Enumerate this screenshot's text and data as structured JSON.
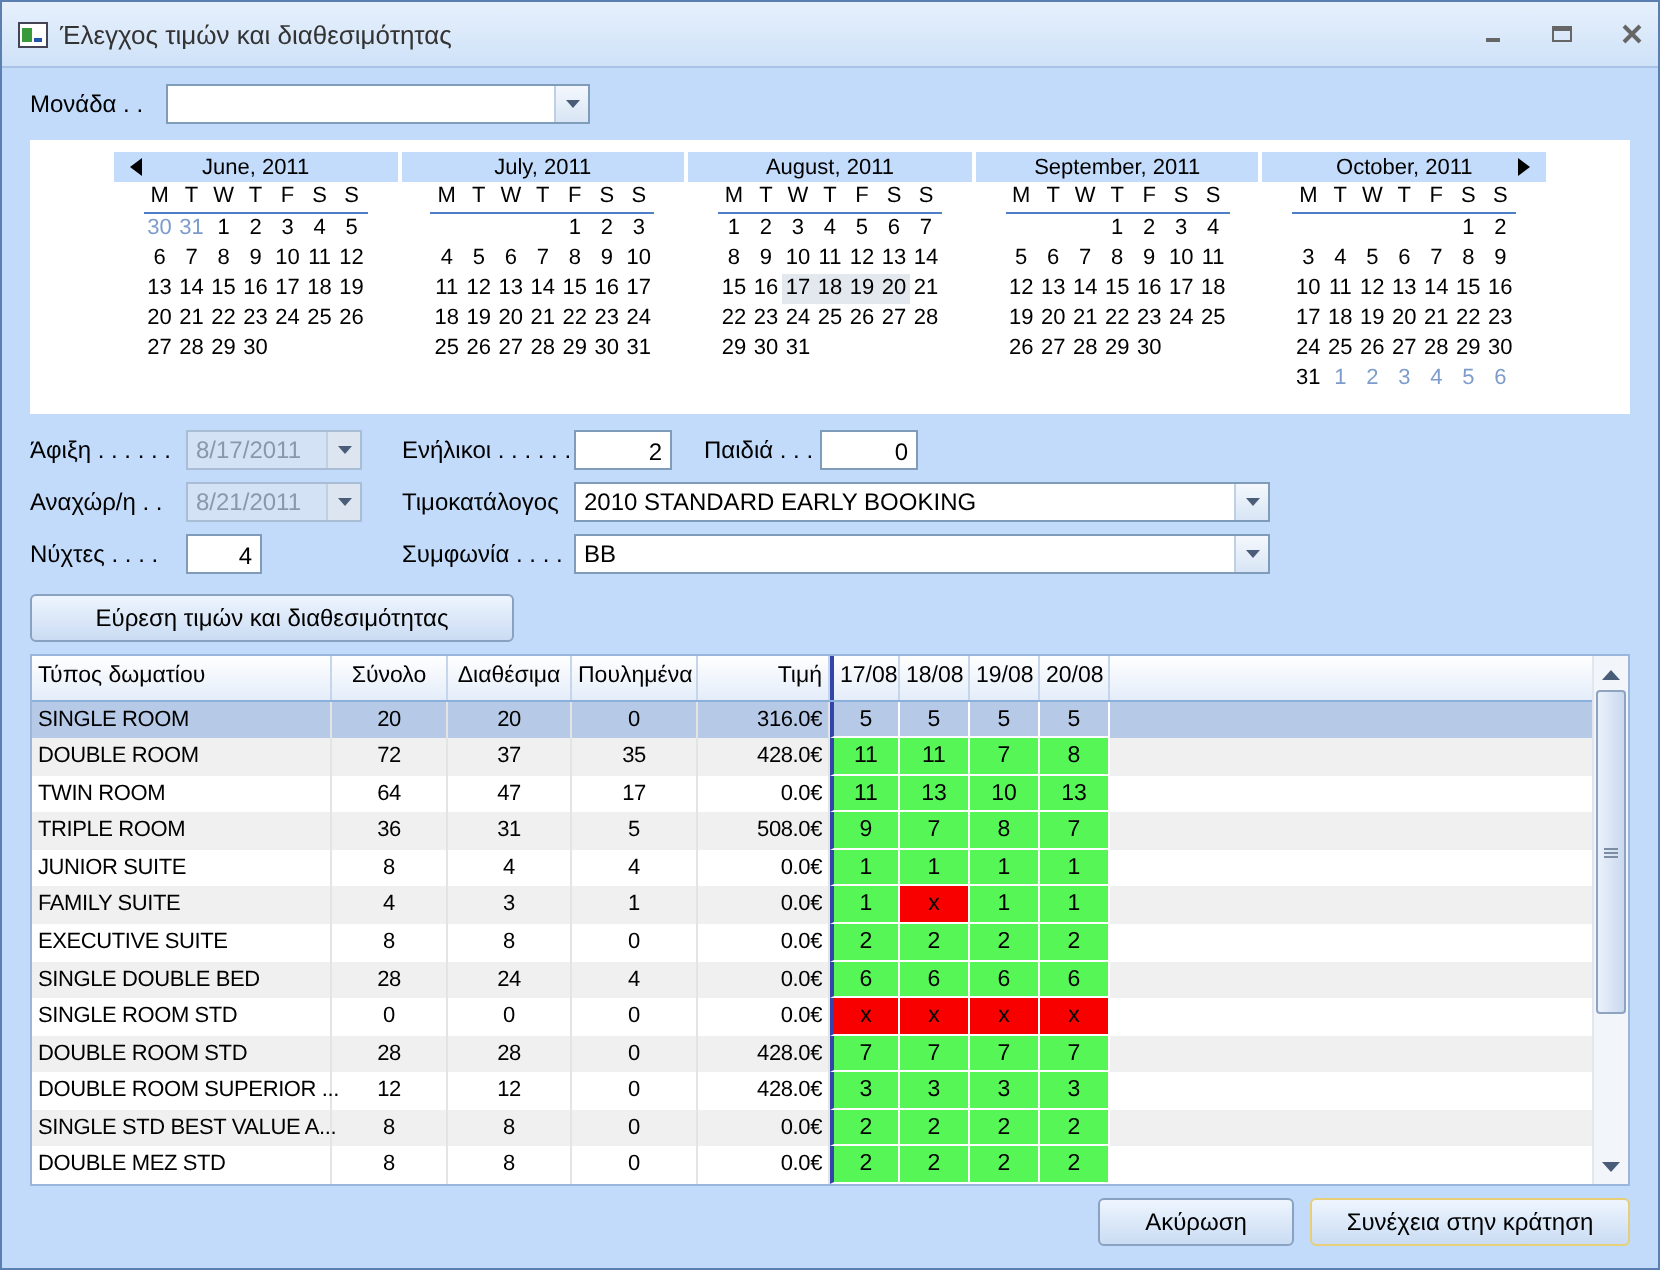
{
  "window": {
    "title": "Έλεγχος τιμών και διαθεσιμότητας"
  },
  "unit": {
    "label": "Μονάδα . ."
  },
  "calendar": {
    "months": [
      {
        "title": "June, 2011",
        "weekdays": [
          "M",
          "T",
          "W",
          "T",
          "F",
          "S",
          "S"
        ],
        "weeks": [
          {
            "days": [
              {
                "d": "30",
                "muted": true,
                "selected": false
              },
              {
                "d": "31",
                "muted": true,
                "selected": false
              },
              {
                "d": "1",
                "muted": false,
                "selected": false
              },
              {
                "d": "2",
                "muted": false,
                "selected": false
              },
              {
                "d": "3",
                "muted": false,
                "selected": false
              },
              {
                "d": "4",
                "muted": false,
                "selected": false
              },
              {
                "d": "5",
                "muted": false,
                "selected": false
              }
            ]
          },
          {
            "days": [
              {
                "d": "6",
                "muted": false,
                "selected": false
              },
              {
                "d": "7",
                "muted": false,
                "selected": false
              },
              {
                "d": "8",
                "muted": false,
                "selected": false
              },
              {
                "d": "9",
                "muted": false,
                "selected": false
              },
              {
                "d": "10",
                "muted": false,
                "selected": false
              },
              {
                "d": "11",
                "muted": false,
                "selected": false
              },
              {
                "d": "12",
                "muted": false,
                "selected": false
              }
            ]
          },
          {
            "days": [
              {
                "d": "13",
                "muted": false,
                "selected": false
              },
              {
                "d": "14",
                "muted": false,
                "selected": false
              },
              {
                "d": "15",
                "muted": false,
                "selected": false
              },
              {
                "d": "16",
                "muted": false,
                "selected": false
              },
              {
                "d": "17",
                "muted": false,
                "selected": false
              },
              {
                "d": "18",
                "muted": false,
                "selected": false
              },
              {
                "d": "19",
                "muted": false,
                "selected": false
              }
            ]
          },
          {
            "days": [
              {
                "d": "20",
                "muted": false,
                "selected": false
              },
              {
                "d": "21",
                "muted": false,
                "selected": false
              },
              {
                "d": "22",
                "muted": false,
                "selected": false
              },
              {
                "d": "23",
                "muted": false,
                "selected": false
              },
              {
                "d": "24",
                "muted": false,
                "selected": false
              },
              {
                "d": "25",
                "muted": false,
                "selected": false
              },
              {
                "d": "26",
                "muted": false,
                "selected": false
              }
            ]
          },
          {
            "days": [
              {
                "d": "27",
                "muted": false,
                "selected": false
              },
              {
                "d": "28",
                "muted": false,
                "selected": false
              },
              {
                "d": "29",
                "muted": false,
                "selected": false
              },
              {
                "d": "30",
                "muted": false,
                "selected": false
              }
            ]
          }
        ]
      },
      {
        "title": "July, 2011",
        "weekdays": [
          "M",
          "T",
          "W",
          "T",
          "F",
          "S",
          "S"
        ],
        "weeks": [
          {
            "days": [
              {
                "d": "1",
                "muted": false,
                "selected": false
              },
              {
                "d": "2",
                "muted": false,
                "selected": false
              },
              {
                "d": "3",
                "muted": false,
                "selected": false
              }
            ]
          },
          {
            "days": [
              {
                "d": "4",
                "muted": false,
                "selected": false
              },
              {
                "d": "5",
                "muted": false,
                "selected": false
              },
              {
                "d": "6",
                "muted": false,
                "selected": false
              },
              {
                "d": "7",
                "muted": false,
                "selected": false
              },
              {
                "d": "8",
                "muted": false,
                "selected": false
              },
              {
                "d": "9",
                "muted": false,
                "selected": false
              },
              {
                "d": "10",
                "muted": false,
                "selected": false
              }
            ]
          },
          {
            "days": [
              {
                "d": "11",
                "muted": false,
                "selected": false
              },
              {
                "d": "12",
                "muted": false,
                "selected": false
              },
              {
                "d": "13",
                "muted": false,
                "selected": false
              },
              {
                "d": "14",
                "muted": false,
                "selected": false
              },
              {
                "d": "15",
                "muted": false,
                "selected": false
              },
              {
                "d": "16",
                "muted": false,
                "selected": false
              },
              {
                "d": "17",
                "muted": false,
                "selected": false
              }
            ]
          },
          {
            "days": [
              {
                "d": "18",
                "muted": false,
                "selected": false
              },
              {
                "d": "19",
                "muted": false,
                "selected": false
              },
              {
                "d": "20",
                "muted": false,
                "selected": false
              },
              {
                "d": "21",
                "muted": false,
                "selected": false
              },
              {
                "d": "22",
                "muted": false,
                "selected": false
              },
              {
                "d": "23",
                "muted": false,
                "selected": false
              },
              {
                "d": "24",
                "muted": false,
                "selected": false
              }
            ]
          },
          {
            "days": [
              {
                "d": "25",
                "muted": false,
                "selected": false
              },
              {
                "d": "26",
                "muted": false,
                "selected": false
              },
              {
                "d": "27",
                "muted": false,
                "selected": false
              },
              {
                "d": "28",
                "muted": false,
                "selected": false
              },
              {
                "d": "29",
                "muted": false,
                "selected": false
              },
              {
                "d": "30",
                "muted": false,
                "selected": false
              },
              {
                "d": "31",
                "muted": false,
                "selected": false
              }
            ]
          }
        ]
      },
      {
        "title": "August, 2011",
        "weekdays": [
          "M",
          "T",
          "W",
          "T",
          "F",
          "S",
          "S"
        ],
        "weeks": [
          {
            "days": [
              {
                "d": "1",
                "muted": false,
                "selected": false
              },
              {
                "d": "2",
                "muted": false,
                "selected": false
              },
              {
                "d": "3",
                "muted": false,
                "selected": false
              },
              {
                "d": "4",
                "muted": false,
                "selected": false
              },
              {
                "d": "5",
                "muted": false,
                "selected": false
              },
              {
                "d": "6",
                "muted": false,
                "selected": false
              },
              {
                "d": "7",
                "muted": false,
                "selected": false
              }
            ]
          },
          {
            "days": [
              {
                "d": "8",
                "muted": false,
                "selected": false
              },
              {
                "d": "9",
                "muted": false,
                "selected": false
              },
              {
                "d": "10",
                "muted": false,
                "selected": false
              },
              {
                "d": "11",
                "muted": false,
                "selected": false
              },
              {
                "d": "12",
                "muted": false,
                "selected": false
              },
              {
                "d": "13",
                "muted": false,
                "selected": false
              },
              {
                "d": "14",
                "muted": false,
                "selected": false
              }
            ]
          },
          {
            "days": [
              {
                "d": "15",
                "muted": false,
                "selected": false
              },
              {
                "d": "16",
                "muted": false,
                "selected": false
              },
              {
                "d": "17",
                "muted": false,
                "selected": true
              },
              {
                "d": "18",
                "muted": false,
                "selected": true
              },
              {
                "d": "19",
                "muted": false,
                "selected": true
              },
              {
                "d": "20",
                "muted": false,
                "selected": true
              },
              {
                "d": "21",
                "muted": false,
                "selected": false
              }
            ]
          },
          {
            "days": [
              {
                "d": "22",
                "muted": false,
                "selected": false
              },
              {
                "d": "23",
                "muted": false,
                "selected": false
              },
              {
                "d": "24",
                "muted": false,
                "selected": false
              },
              {
                "d": "25",
                "muted": false,
                "selected": false
              },
              {
                "d": "26",
                "muted": false,
                "selected": false
              },
              {
                "d": "27",
                "muted": false,
                "selected": false
              },
              {
                "d": "28",
                "muted": false,
                "selected": false
              }
            ]
          },
          {
            "days": [
              {
                "d": "29",
                "muted": false,
                "selected": false
              },
              {
                "d": "30",
                "muted": false,
                "selected": false
              },
              {
                "d": "31",
                "muted": false,
                "selected": false
              }
            ]
          }
        ]
      },
      {
        "title": "September, 2011",
        "weekdays": [
          "M",
          "T",
          "W",
          "T",
          "F",
          "S",
          "S"
        ],
        "weeks": [
          {
            "days": [
              {
                "d": "1",
                "muted": false,
                "selected": false
              },
              {
                "d": "2",
                "muted": false,
                "selected": false
              },
              {
                "d": "3",
                "muted": false,
                "selected": false
              },
              {
                "d": "4",
                "muted": false,
                "selected": false
              }
            ]
          },
          {
            "days": [
              {
                "d": "5",
                "muted": false,
                "selected": false
              },
              {
                "d": "6",
                "muted": false,
                "selected": false
              },
              {
                "d": "7",
                "muted": false,
                "selected": false
              },
              {
                "d": "8",
                "muted": false,
                "selected": false
              },
              {
                "d": "9",
                "muted": false,
                "selected": false
              },
              {
                "d": "10",
                "muted": false,
                "selected": false
              },
              {
                "d": "11",
                "muted": false,
                "selected": false
              }
            ]
          },
          {
            "days": [
              {
                "d": "12",
                "muted": false,
                "selected": false
              },
              {
                "d": "13",
                "muted": false,
                "selected": false
              },
              {
                "d": "14",
                "muted": false,
                "selected": false
              },
              {
                "d": "15",
                "muted": false,
                "selected": false
              },
              {
                "d": "16",
                "muted": false,
                "selected": false
              },
              {
                "d": "17",
                "muted": false,
                "selected": false
              },
              {
                "d": "18",
                "muted": false,
                "selected": false
              }
            ]
          },
          {
            "days": [
              {
                "d": "19",
                "muted": false,
                "selected": false
              },
              {
                "d": "20",
                "muted": false,
                "selected": false
              },
              {
                "d": "21",
                "muted": false,
                "selected": false
              },
              {
                "d": "22",
                "muted": false,
                "selected": false
              },
              {
                "d": "23",
                "muted": false,
                "selected": false
              },
              {
                "d": "24",
                "muted": false,
                "selected": false
              },
              {
                "d": "25",
                "muted": false,
                "selected": false
              }
            ]
          },
          {
            "days": [
              {
                "d": "26",
                "muted": false,
                "selected": false
              },
              {
                "d": "27",
                "muted": false,
                "selected": false
              },
              {
                "d": "28",
                "muted": false,
                "selected": false
              },
              {
                "d": "29",
                "muted": false,
                "selected": false
              },
              {
                "d": "30",
                "muted": false,
                "selected": false
              }
            ]
          }
        ]
      },
      {
        "title": "October, 2011",
        "weekdays": [
          "M",
          "T",
          "W",
          "T",
          "F",
          "S",
          "S"
        ],
        "weeks": [
          {
            "days": [
              {
                "d": "1",
                "muted": false,
                "selected": false
              },
              {
                "d": "2",
                "muted": false,
                "selected": false
              }
            ]
          },
          {
            "days": [
              {
                "d": "3",
                "muted": false,
                "selected": false
              },
              {
                "d": "4",
                "muted": false,
                "selected": false
              },
              {
                "d": "5",
                "muted": false,
                "selected": false
              },
              {
                "d": "6",
                "muted": false,
                "selected": false
              },
              {
                "d": "7",
                "muted": false,
                "selected": false
              },
              {
                "d": "8",
                "muted": false,
                "selected": false
              },
              {
                "d": "9",
                "muted": false,
                "selected": false
              }
            ]
          },
          {
            "days": [
              {
                "d": "10",
                "muted": false,
                "selected": false
              },
              {
                "d": "11",
                "muted": false,
                "selected": false
              },
              {
                "d": "12",
                "muted": false,
                "selected": false
              },
              {
                "d": "13",
                "muted": false,
                "selected": false
              },
              {
                "d": "14",
                "muted": false,
                "selected": false
              },
              {
                "d": "15",
                "muted": false,
                "selected": false
              },
              {
                "d": "16",
                "muted": false,
                "selected": false
              }
            ]
          },
          {
            "days": [
              {
                "d": "17",
                "muted": false,
                "selected": false
              },
              {
                "d": "18",
                "muted": false,
                "selected": false
              },
              {
                "d": "19",
                "muted": false,
                "selected": false
              },
              {
                "d": "20",
                "muted": false,
                "selected": false
              },
              {
                "d": "21",
                "muted": false,
                "selected": false
              },
              {
                "d": "22",
                "muted": false,
                "selected": false
              },
              {
                "d": "23",
                "muted": false,
                "selected": false
              }
            ]
          },
          {
            "days": [
              {
                "d": "24",
                "muted": false,
                "selected": false
              },
              {
                "d": "25",
                "muted": false,
                "selected": false
              },
              {
                "d": "26",
                "muted": false,
                "selected": false
              },
              {
                "d": "27",
                "muted": false,
                "selected": false
              },
              {
                "d": "28",
                "muted": false,
                "selected": false
              },
              {
                "d": "29",
                "muted": false,
                "selected": false
              },
              {
                "d": "30",
                "muted": false,
                "selected": false
              }
            ]
          },
          {
            "days": [
              {
                "d": "31",
                "muted": false,
                "selected": false
              },
              {
                "d": "1",
                "muted": true,
                "selected": false
              },
              {
                "d": "2",
                "muted": true,
                "selected": false
              },
              {
                "d": "3",
                "muted": true,
                "selected": false
              },
              {
                "d": "4",
                "muted": true,
                "selected": false
              },
              {
                "d": "5",
                "muted": true,
                "selected": false
              },
              {
                "d": "6",
                "muted": true,
                "selected": false
              }
            ]
          }
        ]
      }
    ]
  },
  "form": {
    "arrival": {
      "label": "Άφιξη . . . . . .",
      "value": "8/17/2011",
      "disabled": true
    },
    "departure": {
      "label": "Αναχώρ/η . .",
      "value": "8/21/2011",
      "disabled": true
    },
    "nights": {
      "label": "Νύχτες . . . .",
      "value": "4"
    },
    "adults": {
      "label": "Ενήλικοι . . . . . .",
      "value": "2"
    },
    "children": {
      "label": "Παιδιά . . .",
      "value": "0"
    },
    "price_list": {
      "label": "Τιμοκατάλογος",
      "value": "2010 STANDARD EARLY BOOKING"
    },
    "agreement": {
      "label": "Συμφωνία . . . .",
      "value": "BB"
    }
  },
  "search_button": "Εύρεση τιμών και διαθεσιμότητας",
  "table": {
    "columns": [
      "Τύπος δωματίου",
      "Σύνολο",
      "Διαθέσιμα",
      "Πουλημένα",
      "Τιμή",
      "17/08",
      "18/08",
      "19/08",
      "20/08"
    ],
    "rows": [
      {
        "type": "SINGLE ROOM",
        "total": "20",
        "available": "20",
        "sold": "0",
        "price": "316.0€",
        "selected": true,
        "days": [
          {
            "value": "5"
          },
          {
            "value": "5"
          },
          {
            "value": "5"
          },
          {
            "value": "5"
          }
        ]
      },
      {
        "type": "DOUBLE ROOM",
        "total": "72",
        "available": "37",
        "sold": "35",
        "price": "428.0€",
        "selected": false,
        "days": [
          {
            "value": "11",
            "open": true
          },
          {
            "value": "11",
            "open": true
          },
          {
            "value": "7",
            "open": true
          },
          {
            "value": "8",
            "open": true
          }
        ]
      },
      {
        "type": "TWIN ROOM",
        "total": "64",
        "available": "47",
        "sold": "17",
        "price": "0.0€",
        "selected": false,
        "days": [
          {
            "value": "11",
            "open": true
          },
          {
            "value": "13",
            "open": true
          },
          {
            "value": "10",
            "open": true
          },
          {
            "value": "13",
            "open": true
          }
        ]
      },
      {
        "type": "TRIPLE ROOM",
        "total": "36",
        "available": "31",
        "sold": "5",
        "price": "508.0€",
        "selected": false,
        "days": [
          {
            "value": "9",
            "open": true
          },
          {
            "value": "7",
            "open": true
          },
          {
            "value": "8",
            "open": true
          },
          {
            "value": "7",
            "open": true
          }
        ]
      },
      {
        "type": "JUNIOR SUITE",
        "total": "8",
        "available": "4",
        "sold": "4",
        "price": "0.0€",
        "selected": false,
        "days": [
          {
            "value": "1",
            "open": true
          },
          {
            "value": "1",
            "open": true
          },
          {
            "value": "1",
            "open": true
          },
          {
            "value": "1",
            "open": true
          }
        ]
      },
      {
        "type": "FAMILY SUITE",
        "total": "4",
        "available": "3",
        "sold": "1",
        "price": "0.0€",
        "selected": false,
        "days": [
          {
            "value": "1",
            "open": true
          },
          {
            "value": "x",
            "open": false
          },
          {
            "value": "1",
            "open": true
          },
          {
            "value": "1",
            "open": true
          }
        ]
      },
      {
        "type": "EXECUTIVE SUITE",
        "total": "8",
        "available": "8",
        "sold": "0",
        "price": "0.0€",
        "selected": false,
        "days": [
          {
            "value": "2",
            "open": true
          },
          {
            "value": "2",
            "open": true
          },
          {
            "value": "2",
            "open": true
          },
          {
            "value": "2",
            "open": true
          }
        ]
      },
      {
        "type": "SINGLE DOUBLE BED",
        "total": "28",
        "available": "24",
        "sold": "4",
        "price": "0.0€",
        "selected": false,
        "days": [
          {
            "value": "6",
            "open": true
          },
          {
            "value": "6",
            "open": true
          },
          {
            "value": "6",
            "open": true
          },
          {
            "value": "6",
            "open": true
          }
        ]
      },
      {
        "type": "SINGLE ROOM STD",
        "total": "0",
        "available": "0",
        "sold": "0",
        "price": "0.0€",
        "selected": false,
        "days": [
          {
            "value": "x",
            "open": false
          },
          {
            "value": "x",
            "open": false
          },
          {
            "value": "x",
            "open": false
          },
          {
            "value": "x",
            "open": false
          }
        ]
      },
      {
        "type": "DOUBLE ROOM STD",
        "total": "28",
        "available": "28",
        "sold": "0",
        "price": "428.0€",
        "selected": false,
        "days": [
          {
            "value": "7",
            "open": true
          },
          {
            "value": "7",
            "open": true
          },
          {
            "value": "7",
            "open": true
          },
          {
            "value": "7",
            "open": true
          }
        ]
      },
      {
        "type": "DOUBLE ROOM SUPERIOR ...",
        "total": "12",
        "available": "12",
        "sold": "0",
        "price": "428.0€",
        "selected": false,
        "days": [
          {
            "value": "3",
            "open": true
          },
          {
            "value": "3",
            "open": true
          },
          {
            "value": "3",
            "open": true
          },
          {
            "value": "3",
            "open": true
          }
        ]
      },
      {
        "type": "SINGLE STD BEST VALUE A...",
        "total": "8",
        "available": "8",
        "sold": "0",
        "price": "0.0€",
        "selected": false,
        "days": [
          {
            "value": "2",
            "open": true
          },
          {
            "value": "2",
            "open": true
          },
          {
            "value": "2",
            "open": true
          },
          {
            "value": "2",
            "open": true
          }
        ]
      },
      {
        "type": "DOUBLE MEZ STD",
        "total": "8",
        "available": "8",
        "sold": "0",
        "price": "0.0€",
        "selected": false,
        "days": [
          {
            "value": "2",
            "open": true
          },
          {
            "value": "2",
            "open": true
          },
          {
            "value": "2",
            "open": true
          },
          {
            "value": "2",
            "open": true
          }
        ]
      }
    ]
  },
  "buttons": {
    "cancel": "Ακύρωση",
    "continue": "Συνέχεια στην κράτηση"
  }
}
